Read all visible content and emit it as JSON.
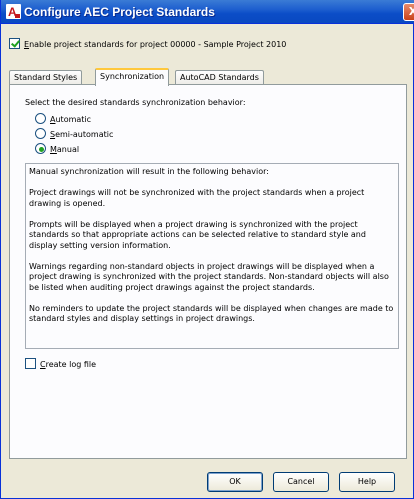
{
  "window": {
    "title": "Configure AEC Project Standards",
    "close_glyph": "X",
    "title_bar_color": "#0a49c1",
    "accent_color": "#ffc83c",
    "check_color": "#21a121",
    "app_icon_letter": "A"
  },
  "enable": {
    "checked": true,
    "label_first": "E",
    "label_rest": "nable project standards for project 00000 - Sample Project 2010"
  },
  "tabs": [
    {
      "label": "Standard Styles",
      "active": false
    },
    {
      "label": "Synchronization",
      "active": true
    },
    {
      "label": "AutoCAD Standards",
      "active": false
    }
  ],
  "sync": {
    "prompt": "Select the desired standards synchronization behavior:",
    "options": [
      {
        "underlined": "A",
        "rest": "utomatic",
        "selected": false
      },
      {
        "underlined": "S",
        "rest": "emi-automatic",
        "selected": false
      },
      {
        "underlined": "M",
        "rest": "anual",
        "selected": true
      }
    ],
    "description": [
      "Manual synchronization will result in the following behavior:",
      "Project drawings will not be synchronized with the project standards when a project drawing is opened.",
      "Prompts will be displayed when a project drawing is synchronized with the project standards so that appropriate actions can be selected relative to standard style and display setting version information.",
      "Warnings regarding non-standard objects in project drawings will be displayed when a project drawing is synchronized with the project standards. Non-standard objects will also be listed when auditing project drawings against the project standards.",
      "No reminders to update the project standards will be displayed when changes are made to standard styles and display settings in project drawings."
    ]
  },
  "log": {
    "checked": false,
    "underlined": "C",
    "rest": "reate log file"
  },
  "buttons": {
    "ok": "OK",
    "cancel": "Cancel",
    "help": "Help"
  }
}
